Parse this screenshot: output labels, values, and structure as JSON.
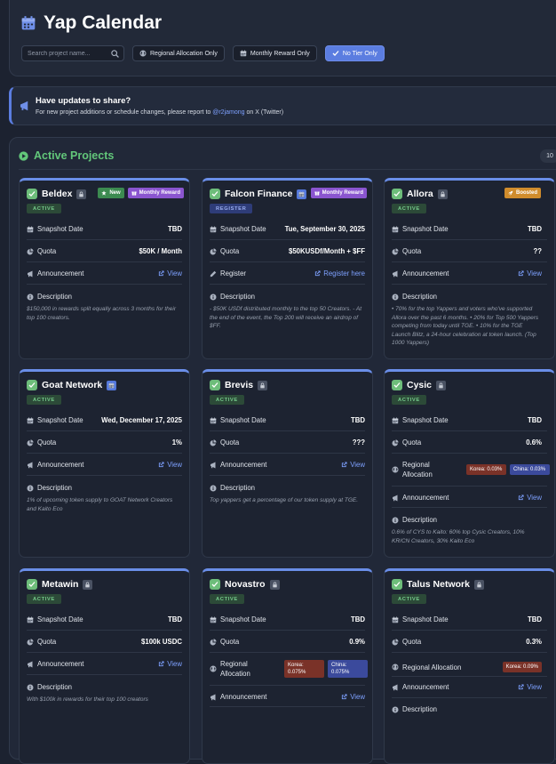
{
  "app": {
    "title": "Yap Calendar"
  },
  "filters": {
    "search_placeholder": "Search project name...",
    "regional": "Regional Allocation Only",
    "monthly": "Monthly Reward Only",
    "notier": "No Tier Only"
  },
  "notice": {
    "title": "Have updates to share?",
    "text_before": "For new project additions or schedule changes, please report to ",
    "handle": "@r2jamong",
    "text_after": " on X (Twitter)"
  },
  "panel": {
    "title": "Active Projects",
    "count": "10"
  },
  "labels": {
    "snapshot": "Snapshot Date",
    "quota": "Quota",
    "announcement": "Announcement",
    "register": "Register",
    "regional": "Regional",
    "allocation": "Allocation",
    "regional_allocation": "Regional Allocation",
    "description": "Description",
    "view": "View",
    "register_here": "Register here"
  },
  "projects": [
    {
      "name": "Beldex",
      "status": "ACTIVE",
      "badges": [
        "New",
        "Monthly Reward"
      ],
      "snapshot": "TBD",
      "quota": "$50K / Month",
      "description": "$150,000 in rewards split equally across 3 months for their top 100 creators."
    },
    {
      "name": "Falcon Finance",
      "status": "REGISTER",
      "badges": [
        "Monthly Reward"
      ],
      "snapshot": "Tue, September 30, 2025",
      "quota": "$50KUSDf/Month + $FF",
      "description": "- $50K USDf distributed monthly to the top 50 Creators. - At the end of the event, the Top 200 will receive an airdrop of $FF."
    },
    {
      "name": "Allora",
      "status": "ACTIVE",
      "badges": [
        "Boosted"
      ],
      "snapshot": "TBD",
      "quota": "??",
      "description": "• 70% for the top Yappers and voters who've supported Allora over the past 6 months. • 20% for Top 500 Yappers competing from today until TGE. • 10% for the TGE Launch Blitz, a 24-hour celebration at token launch. (Top 1000 Yappers)"
    },
    {
      "name": "Goat Network",
      "status": "ACTIVE",
      "snapshot": "Wed, December 17, 2025",
      "quota": "1%",
      "description": "1% of upcoming token supply to GOAT Network Creators and Kaito Eco"
    },
    {
      "name": "Brevis",
      "status": "ACTIVE",
      "snapshot": "TBD",
      "quota": "???",
      "description": "Top yappers get a percentage of our token supply at TGE."
    },
    {
      "name": "Cysic",
      "status": "ACTIVE",
      "snapshot": "TBD",
      "quota": "0.6%",
      "regional": {
        "korea": "Korea: 0.03%",
        "china": "China: 0.03%"
      },
      "description": "0.6% of CYS to Kaito: 60% top Cysic Creators, 10% KR/CN Creators, 30% Kaito Eco"
    },
    {
      "name": "Metawin",
      "status": "ACTIVE",
      "snapshot": "TBD",
      "quota": "$100k USDC",
      "description": "With $100k in rewards for their top 100 creators"
    },
    {
      "name": "Novastro",
      "status": "ACTIVE",
      "snapshot": "TBD",
      "quota": "0.9%",
      "regional": {
        "korea": "Korea: 0.075%",
        "china": "China: 0.075%"
      }
    },
    {
      "name": "Talus Network",
      "status": "ACTIVE",
      "snapshot": "TBD",
      "quota": "0.3%",
      "regional": {
        "korea": "Korea: 0.09%"
      }
    }
  ],
  "colors": {
    "accent": "#5b7de0",
    "active_green": "#62c77a",
    "link": "#7ea1ff"
  }
}
